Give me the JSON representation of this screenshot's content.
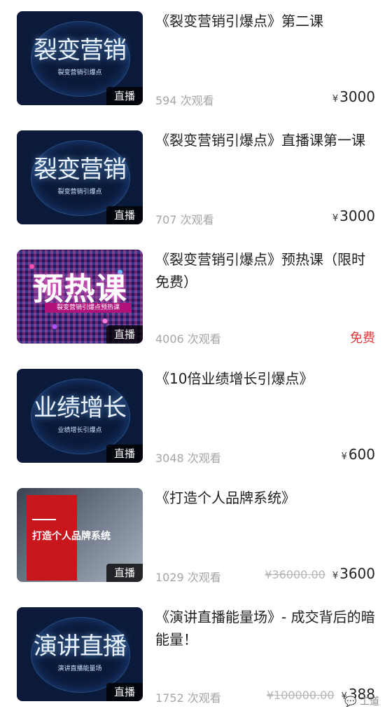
{
  "courses": [
    {
      "thumb_big": "裂变营销",
      "thumb_sub": "裂变营销引爆点",
      "badge": "直播",
      "title": "《裂变营销引爆点》第二课",
      "views": "594 次观看",
      "currency": "¥",
      "price": "3000"
    },
    {
      "thumb_big": "裂变营销",
      "thumb_sub": "裂变营销引爆点",
      "badge": "直播",
      "title": "《裂变营销引爆点》直播课第一课",
      "views": "707 次观看",
      "currency": "¥",
      "price": "3000"
    },
    {
      "thumb_big": "预热课",
      "thumb_sub": "裂变营销引爆点预热课",
      "badge": "直播",
      "title": "《裂变营销引爆点》预热课（限时免费）",
      "views": "4006 次观看",
      "free_label": "免费"
    },
    {
      "thumb_big": "业绩增长",
      "thumb_sub": "业绩增长引爆点",
      "badge": "直播",
      "title": "《10倍业绩增长引爆点》",
      "views": "3048 次观看",
      "currency": "¥",
      "price": "600"
    },
    {
      "thumb_big": "打造个人品牌系统",
      "badge": "直播",
      "title": "《打造个人品牌系统》",
      "views": "1029 次观看",
      "original_price": "¥36000.00",
      "currency": "¥",
      "price": "3600"
    },
    {
      "thumb_big": "演讲直播",
      "thumb_sub": "演讲直播能量场",
      "badge": "直播",
      "title": "《演讲直播能量场》- 成交背后的暗能量！",
      "views": "1752 次观看",
      "original_price": "¥100000.00",
      "currency": "¥",
      "price": "388"
    }
  ],
  "watermark": "工道"
}
